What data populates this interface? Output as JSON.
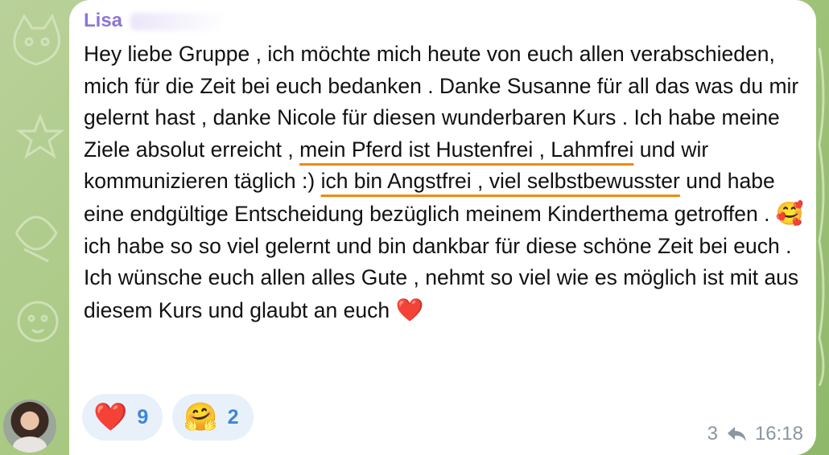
{
  "sender": {
    "name": "Lisa"
  },
  "message": {
    "seg1": "Hey liebe Gruppe , ich möchte mich heute von euch allen verabschieden, mich für die Zeit bei euch bedanken . Danke Susanne für all das was du mir gelernt hast , danke Nicole für diesen wunderbaren Kurs . Ich habe meine Ziele absolut erreicht , ",
    "highlight1": "mein Pferd ist Hustenfrei , Lahmfrei",
    "seg2": " und wir kommunizieren täglich :) ",
    "highlight2": "ich bin Angstfrei , viel selbstbewusster",
    "seg3": " und habe eine endgültige Entscheidung bezüglich meinem Kinderthema getroffen . ",
    "emoji1": "🥰",
    "seg4": " ich habe so so viel gelernt und bin dankbar für diese schöne Zeit bei euch . Ich wünsche euch allen alles Gute , nehmt so viel wie es möglich ist mit aus diesem Kurs und glaubt an euch ",
    "emoji2": "❤️"
  },
  "reactions": [
    {
      "icon": "❤️",
      "icon_name": "red-heart",
      "count": "9"
    },
    {
      "icon": "🤗",
      "icon_name": "hugging-face",
      "count": "2"
    }
  ],
  "meta": {
    "reply_count": "3",
    "time": "16:18"
  },
  "colors": {
    "sender": "#8d74d9",
    "underline": "#f08a0a",
    "reaction_count": "#3d86d6",
    "reaction_bg": "#e8f0fa",
    "meta": "#8a96a3"
  }
}
